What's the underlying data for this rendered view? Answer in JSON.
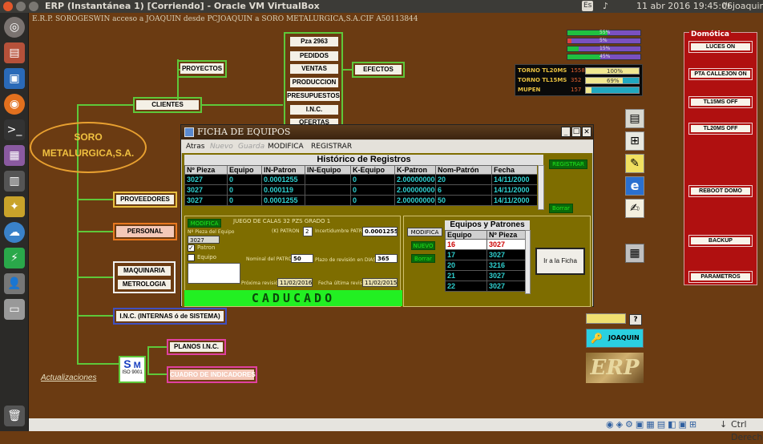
{
  "topbar": {
    "title": "ERP (Instantánea 1) [Corriendo] - Oracle VM VirtualBox",
    "lang": "Es",
    "datetime": "11 abr 2016 19:45:06",
    "user": "joaquin"
  },
  "app": {
    "header": "E.R.P. SOROGESWIN acceso a JOAQUIN desde PCJOAQUIN a SORO METALURGICA,S.A.CIF A50113844"
  },
  "company": {
    "line1": "SORO",
    "line2": "METALURGICA,S.A."
  },
  "nodes": {
    "proyectos": "PROYECTOS",
    "clientes": "CLIENTES",
    "pza": "Pza 2963",
    "pedidos": "PEDIDOS",
    "ventas": "VENTAS",
    "produccion": "PRODUCCION",
    "presupuestos": "PRESUPUESTOS",
    "inc": "I.N.C.",
    "ofertas": "OFERTAS",
    "efectos": "EFECTOS",
    "proveedores": "PROVEEDORES",
    "personal": "PERSONAL",
    "maquinaria": "MAQUINARIA",
    "metrologia": "METROLOGIA",
    "inc_internas": "I.N.C. (INTERNAS ó de SISTEMA)",
    "planos": "PLANOS I.N.C.",
    "cuadro": "CUADRO DE INDICADORES",
    "actualizaciones": "Actualizaciones",
    "iso": "ISO 9001",
    "sm_s": "S",
    "sm_m": "M"
  },
  "bars": [
    {
      "label": "55%",
      "fill": 0.55
    },
    {
      "label": "5%",
      "fill": 0.05
    },
    {
      "label": "15%",
      "fill": 0.15
    },
    {
      "label": "45%",
      "fill": 0.45
    }
  ],
  "machines": [
    {
      "name": "TORNO TL20MS",
      "count": "1558",
      "pct": "100%",
      "fill": 1.0
    },
    {
      "name": "TORNO TL15MS",
      "count": "352",
      "pct": "69%",
      "fill": 0.69
    },
    {
      "name": "MUPEN",
      "count": "157",
      "pct": "",
      "fill": 0.1
    }
  ],
  "domotica": {
    "title": "Domótica",
    "buttons": [
      "LUCES ON",
      "PTA CALLEJON ON",
      "TL15MS OFF",
      "TL20MS OFF",
      "REBOOT DOMO",
      "BACKUP",
      "PARAMETROS"
    ]
  },
  "user_panel": {
    "help": "?",
    "user": "JOAQUIN",
    "logo": "ERP"
  },
  "dialog": {
    "title": "FICHA DE EQUIPOS",
    "menu": [
      "Atras",
      "Nuevo",
      "Guarda",
      "MODIFICA",
      "REGISTRAR"
    ],
    "hist_title": "Histórico de Registros",
    "hist_cols": [
      "Nº Pieza",
      "Equipo",
      "IN-Patron",
      "IN-Equipo",
      "K-Equipo",
      "K-Patron",
      "Nom-Patrón",
      "Fecha"
    ],
    "hist_rows": [
      [
        "3027",
        "0",
        "0.0001255",
        "",
        "0",
        "2.000000000",
        "20",
        "14/11/2000"
      ],
      [
        "3027",
        "0",
        "0.000119",
        "",
        "0",
        "2.000000000",
        "6",
        "14/11/2000"
      ],
      [
        "3027",
        "0",
        "0.0001255",
        "",
        "0",
        "2.000000000",
        "50",
        "14/11/2000"
      ]
    ],
    "registrar": "REGISTRAR",
    "borrar": "Borrar",
    "form": {
      "modifica": "MODIFICA",
      "title": "JUEGO DE CALAS 32 PZS GRADO 1",
      "pieza_label": "Nº Pieza del Equipo",
      "pieza_value": "3027",
      "kpatron_label": "(K) PATRON",
      "kpatron_value": "2",
      "incert_label": "Incertidumbre PATRON",
      "incert_value": "0.0001255",
      "patron_label": "Patron",
      "equipo_label": "Equipo",
      "nominal_label": "Nominal del PATRON",
      "nominal_value": "50",
      "plazo_label": "Plazo de revisión en DIAS",
      "plazo_value": "365",
      "proxima_label": "Próxima revisión",
      "proxima_value": "11/02/2016",
      "fecha_label": "Fecha última revisión",
      "fecha_value": "11/02/2015",
      "status": "CADUCADO"
    },
    "side": {
      "modifica": "MODIFICA",
      "nuevo": "NUEVO",
      "borrar": "Borrar",
      "ficha": "Ir a la Ficha",
      "title": "Equipos y Patrones",
      "cols": [
        "Equipo",
        "Nº Pieza"
      ],
      "rows": [
        [
          "16",
          "3027"
        ],
        [
          "17",
          "3027"
        ],
        [
          "20",
          "3216"
        ],
        [
          "21",
          "3027"
        ],
        [
          "22",
          "3027"
        ]
      ]
    }
  },
  "statusbar": {
    "host": "Ctrl Derecho"
  }
}
